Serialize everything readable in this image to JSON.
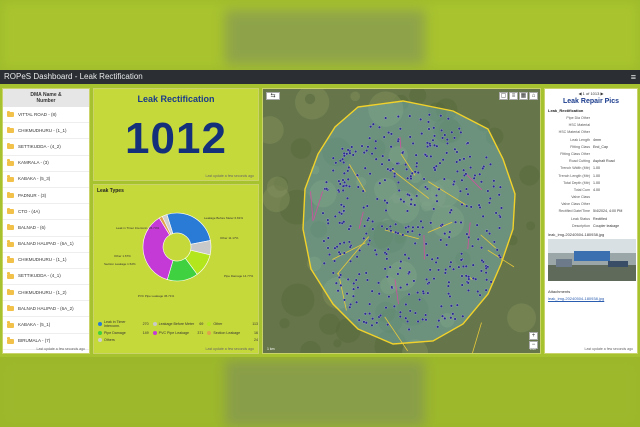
{
  "app": {
    "title": "ROPeS Dashboard - Leak Rectification",
    "menu_icon": "menu-icon"
  },
  "dma_list": {
    "header": "DMA Name & Number",
    "items": [
      "VITTAL ROAD - (8)",
      "CHIKMUDHURU - (1_1)",
      "SETTIKUDDA - (4_2)",
      "KAMRALA - (3)",
      "KABAKA - (5_3)",
      "PADNUR - (3)",
      "CTO - (4A)",
      "BALNAD - (6)",
      "BALNAD HALIPAD - (6A_1)",
      "CHIKMUDHURU - (1_1)",
      "SETTIKUDDA - (4_1)",
      "CHIKMUDHURU - (1_2)",
      "BALNAD HALIPAD - (6A_2)",
      "KABAKA - (5_1)",
      "BIRUMALA - (7)"
    ],
    "footer": "Last update a few seconds ago"
  },
  "kpi": {
    "title": "Leak Rectification",
    "value": "1012",
    "footer": "Last update a few seconds ago"
  },
  "leak_types": {
    "title": "Leak Types",
    "footer": "Last update a few seconds ago",
    "colors": {
      "leak_inner": "#2a7bd6",
      "leakage_before_meter": "#c9c9c9",
      "other": "#b4e61e",
      "pipe_damage": "#3fd13f",
      "pvc_leakage": "#c43ad6",
      "section_leakage": "#e0a24a",
      "others": "#d0d0d0"
    },
    "slice_labels": [
      "Leak in Timer Interconn. 26.74%",
      "Leakage Before Meter 6.81%",
      "Other 11.17%",
      "Pipe Damage 14.77%",
      "PVC Pipe Leakage 36.71%",
      "Other 1.67%",
      "Section Leakage 1.52%"
    ],
    "legend": [
      {
        "name": "Leak in Timer Interconn.",
        "value": "270"
      },
      {
        "name": "Leakage Before Meter",
        "value": "69"
      },
      {
        "name": "Other",
        "value": "113"
      },
      {
        "name": "Pipe Damage",
        "value": "149"
      },
      {
        "name": "PVC Pipe Leakage",
        "value": "371"
      },
      {
        "name": "Section Leakage",
        "value": "16"
      },
      {
        "name": "Others",
        "value": "24"
      }
    ]
  },
  "map": {
    "zoom_in": "+",
    "zoom_out": "−",
    "scale": "1 km",
    "attribution": "Esri"
  },
  "repair": {
    "pager": "1 of 1013",
    "title": "Leak Repair Pics",
    "section": "Leak_Rectification",
    "attributes": [
      {
        "k": "Pipe Dia Other",
        "v": ""
      },
      {
        "k": "HSC Material",
        "v": ""
      },
      {
        "k": "HSC Material Other",
        "v": ""
      },
      {
        "k": "Leak Length",
        "v": "4mm"
      },
      {
        "k": "Fitting Class",
        "v": "End_Cap"
      },
      {
        "k": "Fitting Class Other",
        "v": ""
      },
      {
        "k": "Road Cutting",
        "v": "Asphalt Road"
      },
      {
        "k": "Trench Width (Mtr)",
        "v": "1.00"
      },
      {
        "k": "Trench Length (Mtr)",
        "v": "1.00"
      },
      {
        "k": "Total Depth (Mtr)",
        "v": "1.00"
      },
      {
        "k": "Total Cum",
        "v": "4.00"
      },
      {
        "k": "Valve Class",
        "v": ""
      },
      {
        "k": "Valve Class Other",
        "v": ""
      },
      {
        "k": "Rectified Date/Time",
        "v": "5/4/2024, 4:00 PM"
      },
      {
        "k": "Leak Status",
        "v": "Rectified"
      },
      {
        "k": "Description",
        "v": "Coupler leakage"
      }
    ],
    "image_name": "leak_img-20240504-180938.jpg",
    "attachments_label": "Attachments",
    "attachment_link": "leak_img-20240504-180938.jpg",
    "footer": "Last update a few seconds ago"
  }
}
